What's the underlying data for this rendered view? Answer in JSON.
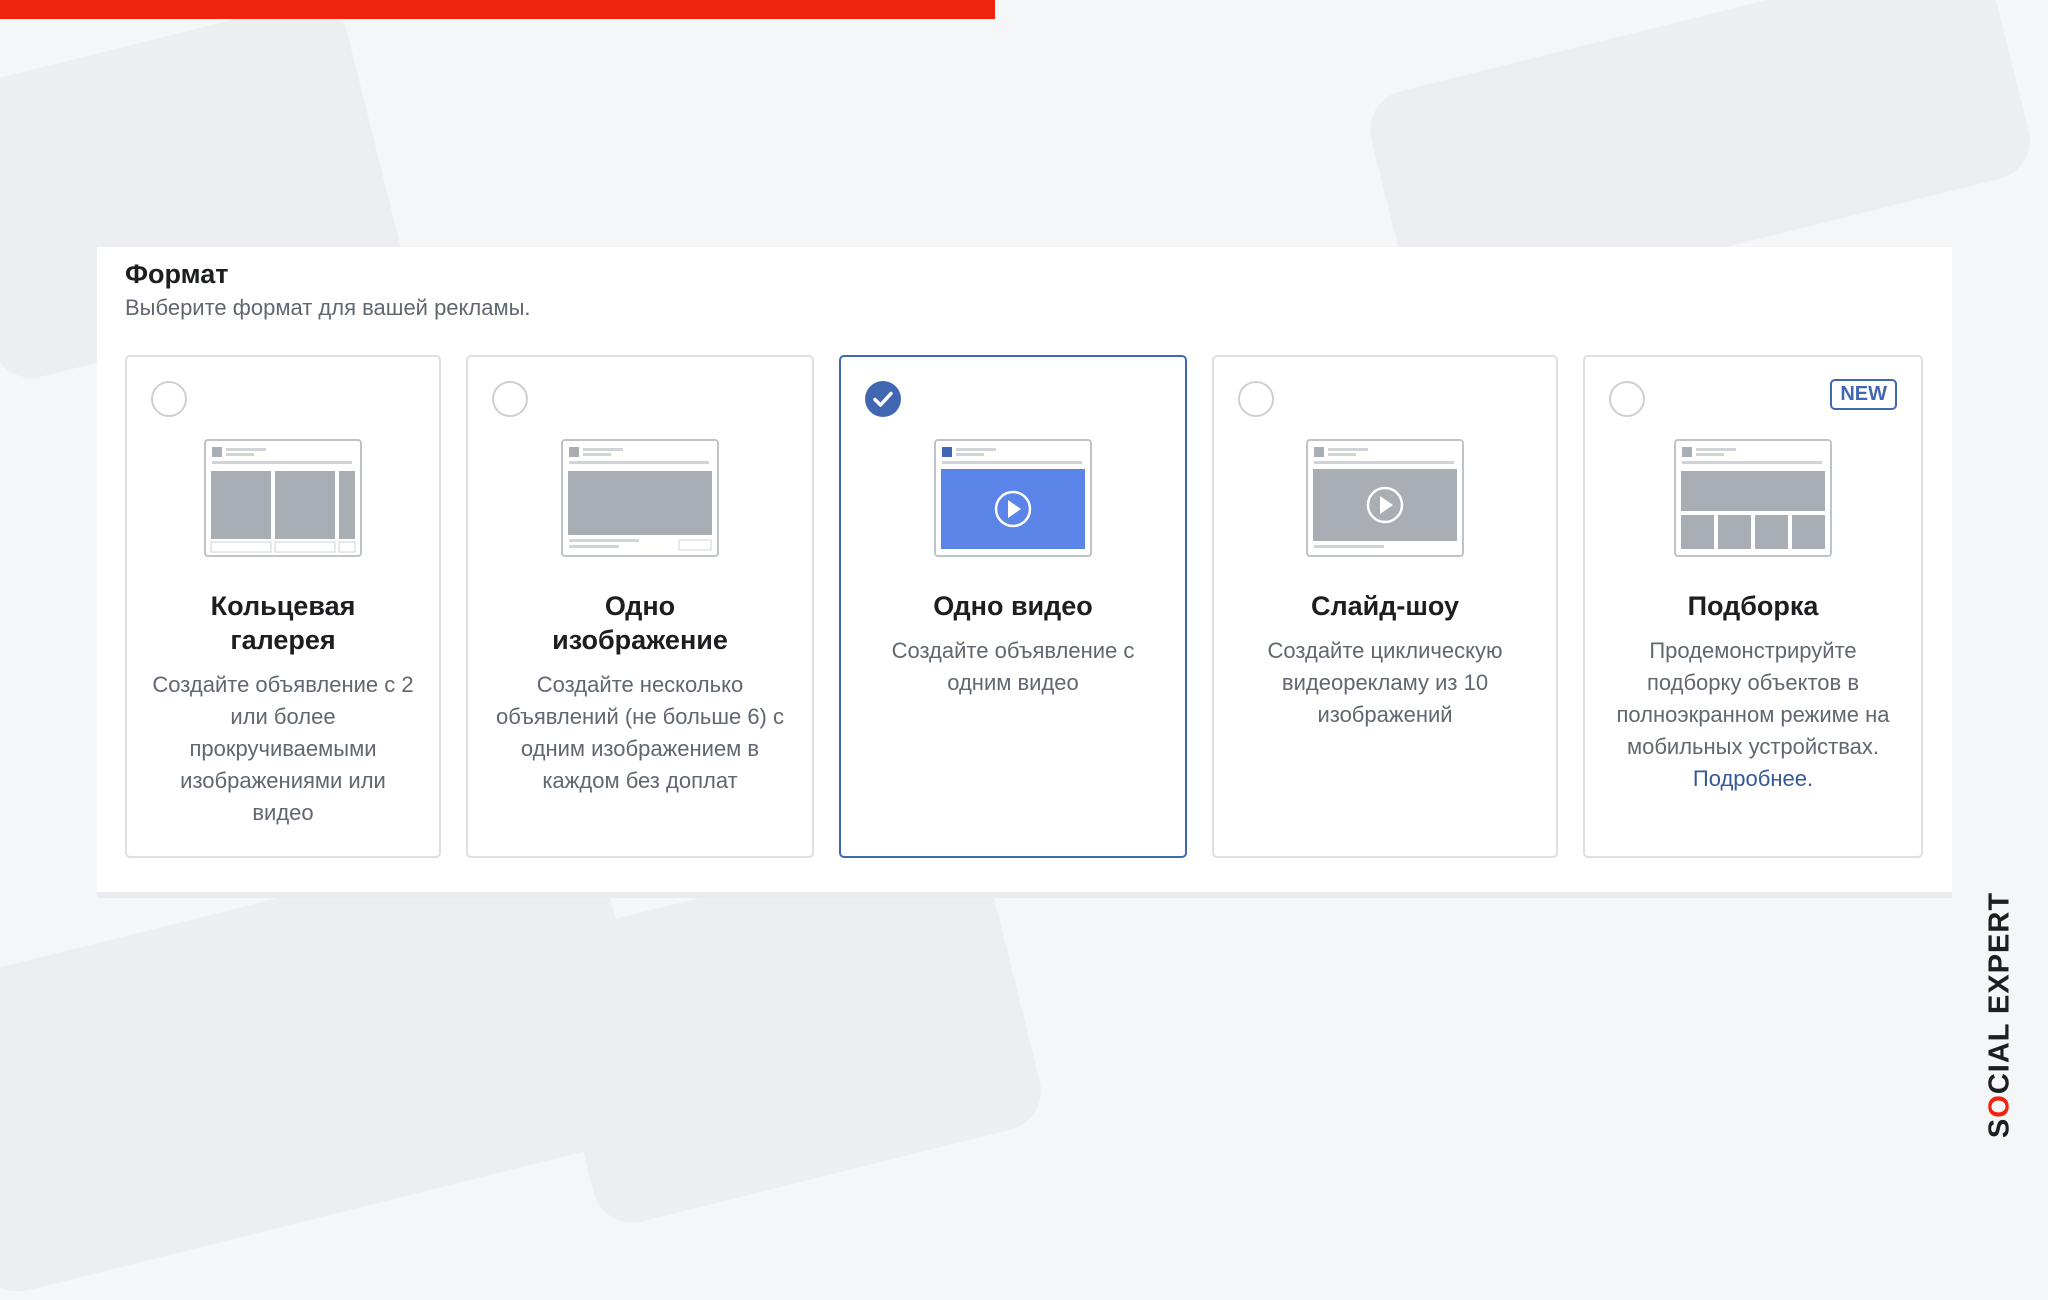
{
  "section": {
    "title": "Формат",
    "subtitle": "Выберите формат для вашей рекламы."
  },
  "cards": [
    {
      "title": "Кольцевая галерея",
      "description": "Создайте объявление с 2 или более прокручиваемыми изображениями или видео",
      "selected": false,
      "thumbnail": "carousel-thumbnail"
    },
    {
      "title": "Одно изображение",
      "description": "Создайте несколько объявлений (не больше 6) с одним изображением в каждом без доплат",
      "selected": false,
      "thumbnail": "single-image-thumbnail"
    },
    {
      "title": "Одно видео",
      "description": "Создайте объявление с одним видео",
      "selected": true,
      "thumbnail": "single-video-thumbnail"
    },
    {
      "title": "Слайд-шоу",
      "description": "Создайте циклическую видеорекламу из 10 изображений",
      "selected": false,
      "thumbnail": "slideshow-thumbnail"
    },
    {
      "title": "Подборка",
      "description": "Продемонстрируйте подборку объектов в полноэкранном режиме на мобильных устройствах.",
      "link": "Подробнее.",
      "badge": "NEW",
      "selected": false,
      "thumbnail": "collection-thumbnail"
    }
  ],
  "brand": {
    "logo_prefix": "S",
    "logo_dot": "O",
    "logo_suffix": "CIAL EXPERT"
  },
  "colors": {
    "accent": "#4267b2",
    "brand_red": "#f0230e",
    "border": "#dddfe2"
  }
}
